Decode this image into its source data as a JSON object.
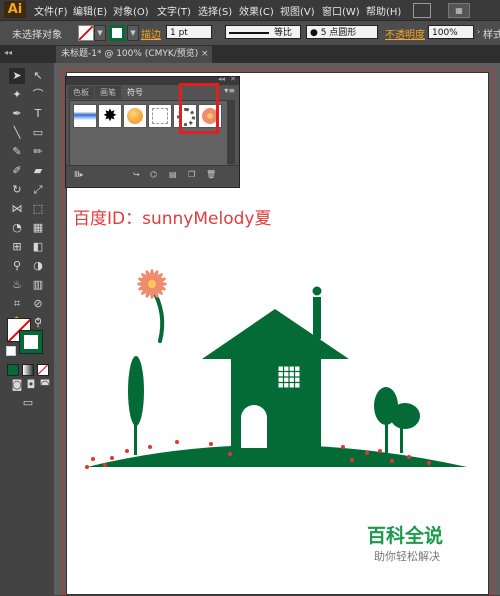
{
  "app": {
    "logo": "Ai"
  },
  "menu": [
    "文件(F)",
    "编辑(E)",
    "对象(O)",
    "文字(T)",
    "选择(S)",
    "效果(C)",
    "视图(V)",
    "窗口(W)",
    "帮助(H)"
  ],
  "control_bar": {
    "selection_status": "未选择对象",
    "stroke_label": "描边",
    "stroke_weight": "1 pt",
    "profile": "等比",
    "brush": "● 5 点圆形",
    "opacity_label": "不透明度",
    "opacity_value": "100%",
    "style_label": "样式"
  },
  "document_tab": {
    "title": "未标题-1* @ 100% (CMYK/预览)",
    "close": "×"
  },
  "panel": {
    "tabs": [
      "色板",
      "画笔",
      "符号"
    ],
    "active_tab": "符号",
    "symbols": [
      "blue-brush-stroke",
      "ink-splat",
      "orange-button",
      "frame",
      "grunge-ring",
      "daisy-flower"
    ],
    "selected_symbol": "daisy-flower",
    "footer_icons": [
      "symbol-library-icon",
      "place-symbol-icon",
      "break-link-icon",
      "symbol-options-icon",
      "new-symbol-icon",
      "delete-symbol-icon"
    ]
  },
  "canvas": {
    "watermark": "百度ID：sunnyMelody夏",
    "brand_title": "百科全说",
    "brand_subtitle": "助你轻松解决",
    "illustration_color": "#046b37",
    "flower_color": "#f08c6e",
    "dot_color": "#e8342f"
  },
  "colors": {
    "accent": "#f5a623",
    "highlight": "#e8342f"
  }
}
